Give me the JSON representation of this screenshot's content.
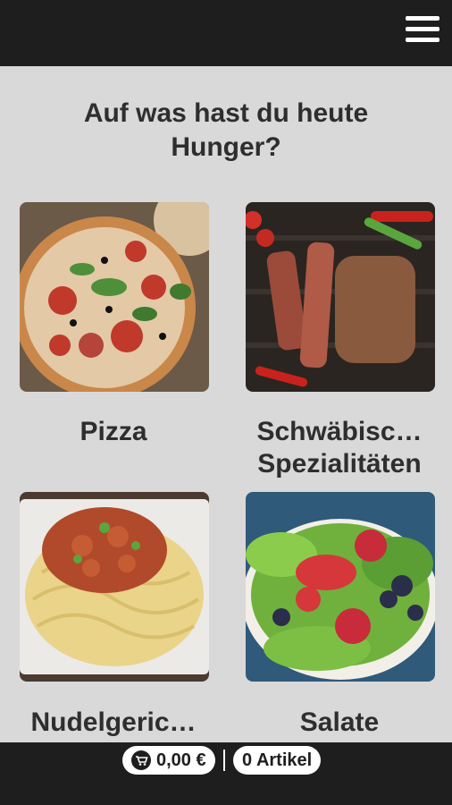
{
  "header": {
    "menu_icon": "hamburger-icon"
  },
  "headline": "Auf was hast du heute Hunger?",
  "categories": [
    {
      "label": "Pizza"
    },
    {
      "label_line1": "Schwäbisc…",
      "label_line2": "Spezialitäten"
    },
    {
      "label": "Nudelgeric…"
    },
    {
      "label": "Salate"
    }
  ],
  "cart": {
    "icon": "cart-icon",
    "total": "0,00 €",
    "items": "0 Artikel"
  },
  "colors": {
    "bar": "#1e1e1e",
    "background": "#d9d9d9",
    "text": "#2e2e2e"
  }
}
